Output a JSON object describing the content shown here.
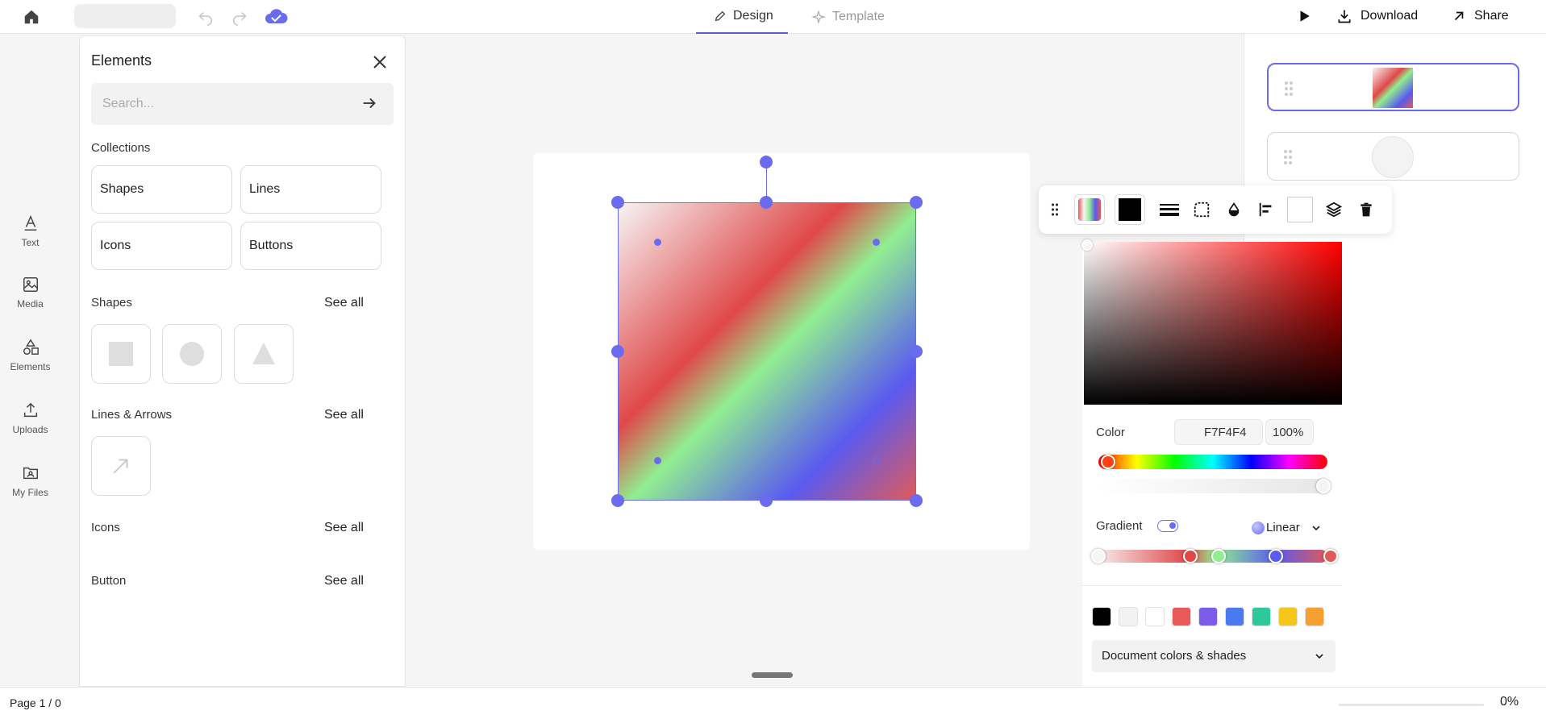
{
  "header": {
    "tabs": [
      {
        "label": "Design",
        "active": true
      },
      {
        "label": "Template",
        "active": false
      }
    ],
    "actions": {
      "download": "Download",
      "share": "Share"
    }
  },
  "rail": {
    "items": [
      {
        "label": "Text",
        "icon": "text-icon"
      },
      {
        "label": "Media",
        "icon": "media-icon"
      },
      {
        "label": "Elements",
        "icon": "elements-icon"
      },
      {
        "label": "Uploads",
        "icon": "upload-icon"
      },
      {
        "label": "My Files",
        "icon": "folder-icon"
      }
    ]
  },
  "elements_panel": {
    "title": "Elements",
    "search_placeholder": "Search...",
    "collections_title": "Collections",
    "collections": [
      "Shapes",
      "Lines",
      "Icons",
      "Buttons"
    ],
    "shapes_title": "Shapes",
    "lines_title": "Lines & Arrows",
    "icons_title": "Icons",
    "button_title": "Button",
    "see_all": "See all"
  },
  "color_picker": {
    "color_label": "Color",
    "hex": "F7F4F4",
    "opacity": "100%",
    "gradient_label": "Gradient",
    "gradient_enabled": true,
    "gradient_type": "Linear",
    "gradient_stops": [
      "#f7f4f4",
      "#e04848",
      "#90ee90",
      "#5a5af0",
      "#e05a5a"
    ],
    "swatches": [
      "#000000",
      "#f2f2f2",
      "#ffffff",
      "#e85a5a",
      "#7b5be8",
      "#4a7af0",
      "#2ec99a",
      "#f5c518",
      "#f5a030"
    ],
    "document_colors_label": "Document colors & shades",
    "shades": [
      "#8a5a5a",
      "#a88a8a",
      "#bfa5a5",
      "#ccb4b4",
      "#d9c7c7",
      "#efe7e7",
      "#efe7e7",
      "#efe7e7",
      "#e9dcdc"
    ]
  },
  "footer": {
    "page_indicator": "Page 1 / 0",
    "zoom": "0%"
  }
}
